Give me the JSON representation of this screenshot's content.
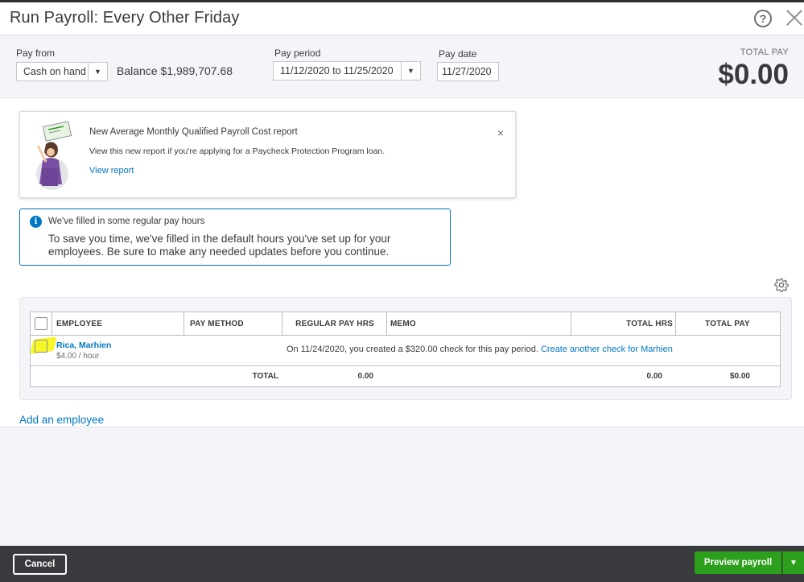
{
  "window": {
    "title": "Run Payroll: Every Other Friday",
    "help_label": "?"
  },
  "header": {
    "pay_from_label": "Pay from",
    "pay_from_value": "Cash on hand",
    "balance": "Balance $1,989,707.68",
    "pay_period_label": "Pay period",
    "pay_period_value": "11/12/2020 to 11/25/2020",
    "pay_date_label": "Pay date",
    "pay_date_value": "11/27/2020",
    "total_pay_label": "TOTAL PAY",
    "total_pay_value": "$0.00"
  },
  "notice": {
    "title": "New Average Monthly Qualified Payroll Cost report",
    "body": "View this new report if you're applying for a Paycheck Protection Program loan.",
    "link": "View report",
    "close": "×"
  },
  "info": {
    "icon": "i",
    "title": "We've filled in some regular pay hours",
    "body": "To save you time, we've filled in the default hours you've set up for your employees. Be sure to make any needed updates before you continue."
  },
  "table": {
    "columns": [
      "EMPLOYEE",
      "PAY METHOD",
      "REGULAR PAY HRS",
      "MEMO",
      "TOTAL HRS",
      "TOTAL PAY"
    ],
    "rows": [
      {
        "name": "Rica, Marhien",
        "rate": "$4.00 / hour",
        "message": "On 11/24/2020, you created a $320.00 check for this pay period.",
        "link": "Create another check for Marhien"
      }
    ],
    "totals": {
      "label": "TOTAL",
      "regular_hrs": "0.00",
      "total_hrs": "0.00",
      "total_pay": "$0.00"
    }
  },
  "add_employee": "Add an employee",
  "footer": {
    "cancel": "Cancel",
    "preview": "Preview payroll",
    "preview_caret": "▼"
  },
  "colors": {
    "accent": "#0077c5",
    "primary_button": "#2ca01c",
    "footer_bg": "#393a3d",
    "highlight": "#f5f51e"
  },
  "icons": [
    "help-icon",
    "close-icon",
    "dropdown-caret-icon",
    "info-icon",
    "gear-icon",
    "illustration"
  ]
}
